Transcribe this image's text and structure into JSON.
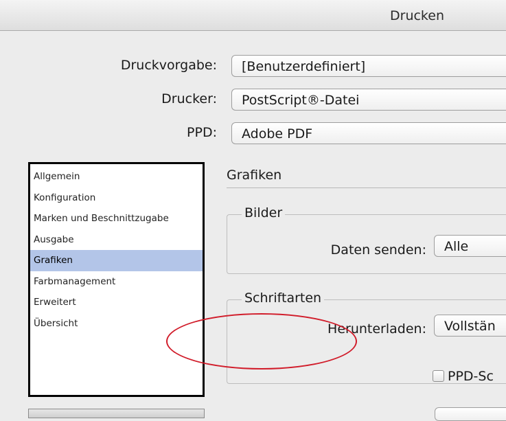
{
  "window": {
    "title": "Drucken"
  },
  "header_fields": [
    {
      "label": "Druckvorgabe:",
      "value": "[Benutzerdefiniert]"
    },
    {
      "label": "Drucker:",
      "value": "PostScript®-Datei"
    },
    {
      "label": "PPD:",
      "value": "Adobe PDF"
    }
  ],
  "sidebar": {
    "items": [
      {
        "label": "Allgemein"
      },
      {
        "label": "Konfiguration"
      },
      {
        "label": "Marken und Beschnittzugabe"
      },
      {
        "label": "Ausgabe"
      },
      {
        "label": "Grafiken",
        "selected": true
      },
      {
        "label": "Farbmanagement"
      },
      {
        "label": "Erweitert"
      },
      {
        "label": "Übersicht"
      }
    ]
  },
  "main": {
    "section_title": "Grafiken",
    "images_group": {
      "title": "Bilder",
      "send_data_label": "Daten senden:",
      "send_data_value": "Alle"
    },
    "fonts_group": {
      "title": "Schriftarten",
      "download_label": "Herunterladen:",
      "download_value": "Vollstän",
      "ppd_checkbox_label": "PPD-Sc",
      "ppd_checked": false
    }
  },
  "colors": {
    "selection": "#b3c5e8",
    "annotation": "#d11c2a",
    "window_bg": "#ececec"
  }
}
